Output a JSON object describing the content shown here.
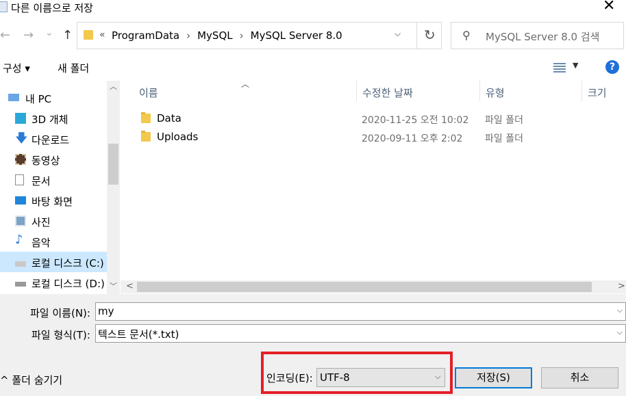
{
  "window": {
    "title": "다른 이름으로 저장",
    "close_glyph": "✕"
  },
  "nav": {
    "back_glyph": "←",
    "forward_glyph": "→",
    "recent_glyph": "⌄",
    "up_glyph": "↑",
    "breadcrumb_overflow": "«",
    "breadcrumb": [
      "ProgramData",
      "MySQL",
      "MySQL Server 8.0"
    ],
    "refresh_glyph": "↻"
  },
  "search": {
    "placeholder": "MySQL Server 8.0 검색"
  },
  "toolbar": {
    "organize_label": "구성 ▾",
    "new_folder_label": "새 폴더",
    "help_label": "?"
  },
  "tree": {
    "items": [
      {
        "label": "내 PC",
        "icon": "computer-icon"
      },
      {
        "label": "3D 개체",
        "icon": "cube-icon"
      },
      {
        "label": "다운로드",
        "icon": "download-arrow-icon"
      },
      {
        "label": "동영상",
        "icon": "film-icon"
      },
      {
        "label": "문서",
        "icon": "document-icon"
      },
      {
        "label": "바탕 화면",
        "icon": "desktop-icon"
      },
      {
        "label": "사진",
        "icon": "picture-icon"
      },
      {
        "label": "음악",
        "icon": "music-note-icon"
      },
      {
        "label": "로컬 디스크 (C:)",
        "icon": "windows-drive-icon",
        "selected": true
      },
      {
        "label": "로컬 디스크 (D:)",
        "icon": "drive-icon"
      }
    ]
  },
  "list": {
    "columns": [
      "이름",
      "수정한 날짜",
      "유형",
      "크기"
    ],
    "rows": [
      {
        "name": "Data",
        "date": "2020-11-25 오전 10:02",
        "type": "파일 폴더"
      },
      {
        "name": "Uploads",
        "date": "2020-09-11 오후 2:02",
        "type": "파일 폴더"
      }
    ]
  },
  "form": {
    "filename_label": "파일 이름(N):",
    "filename_value": "my",
    "filetype_label": "파일 형식(T):",
    "filetype_value": "텍스트 문서(*.txt)",
    "hide_folders_label": "^ 폴더 숨기기",
    "encoding_label": "인코딩(E):",
    "encoding_value": "UTF-8",
    "save_label": "저장(S)",
    "cancel_label": "취소"
  },
  "colors": {
    "highlight_border": "#e41e26",
    "selected_tree": "#cce8ff",
    "help_blue": "#1e6fd9",
    "folder_yellow": "#f2c94c"
  }
}
